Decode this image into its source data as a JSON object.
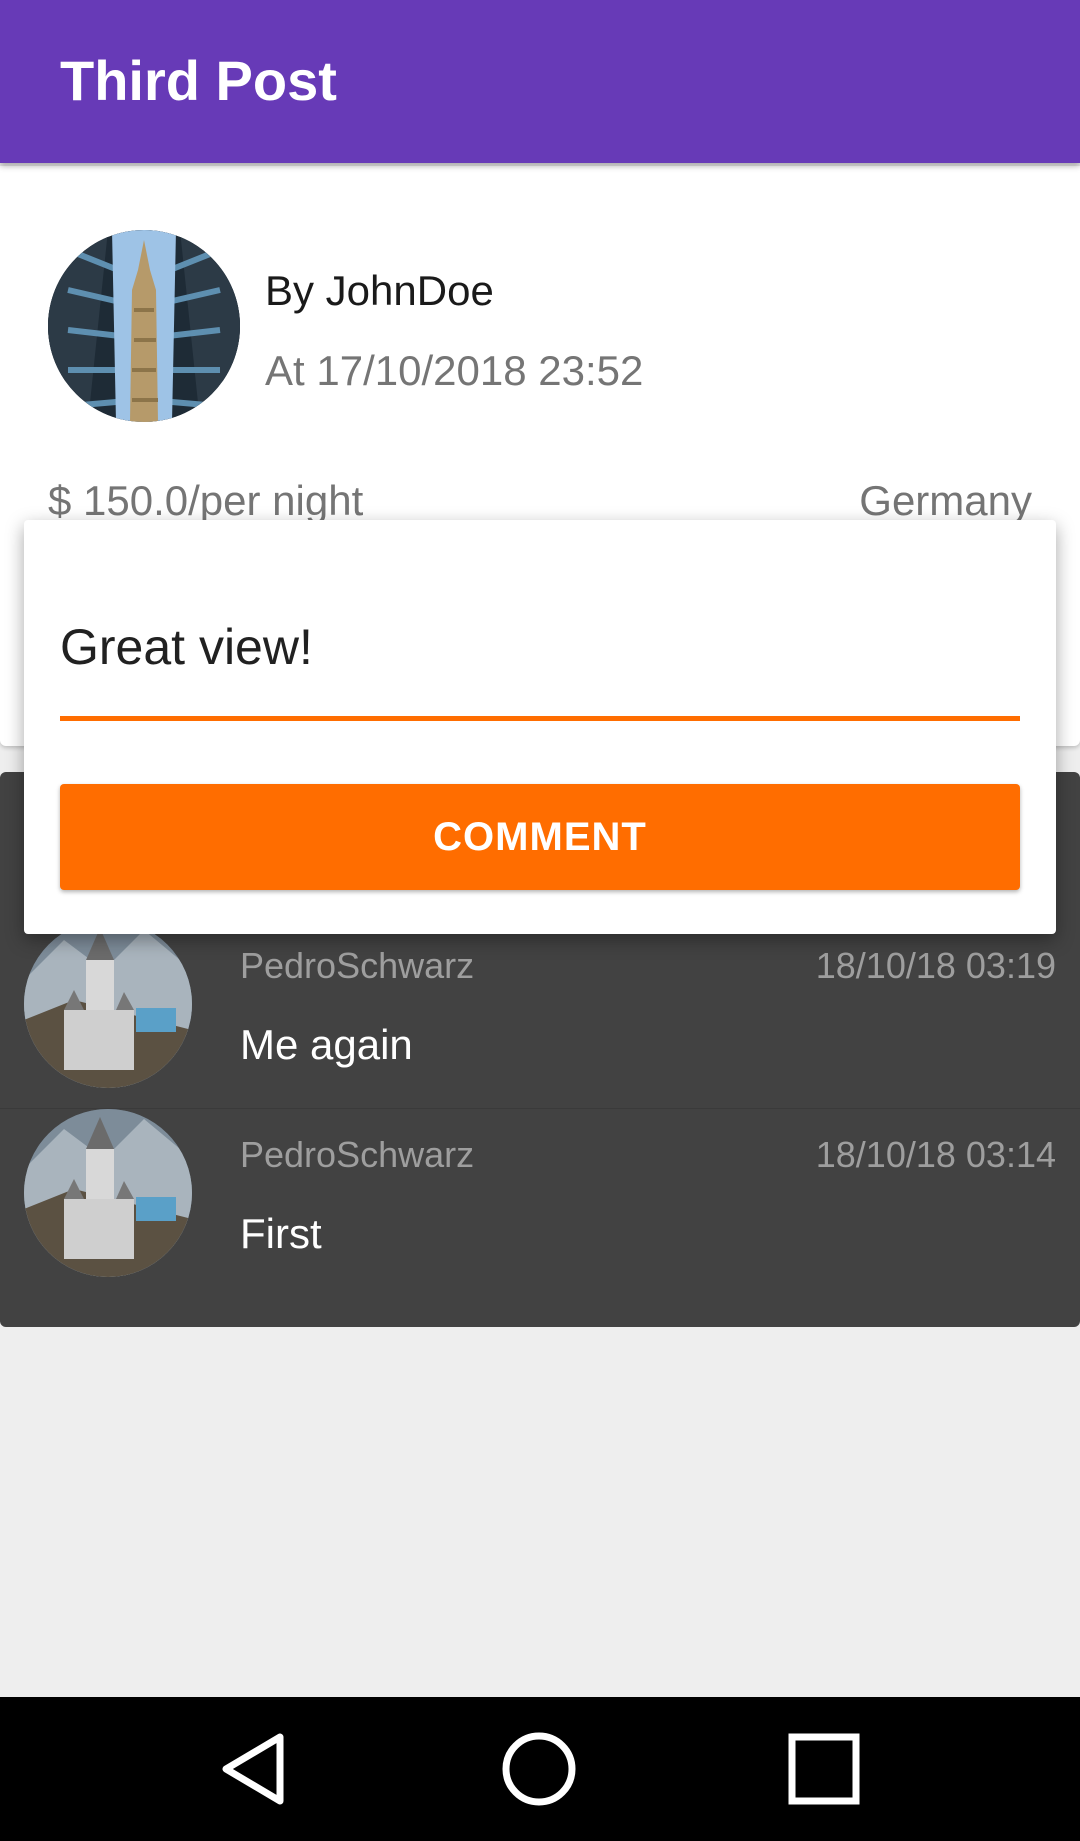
{
  "app_bar": {
    "title": "Third Post"
  },
  "post": {
    "author_line": "By JohnDoe",
    "date_line": "At 17/10/2018 23:52",
    "price": "$ 150.0/per night",
    "country": "Germany"
  },
  "dialog": {
    "input_value": "Great view!",
    "button_label": "COMMENT"
  },
  "comments": [
    {
      "user": "PedroSchwarz",
      "time": "18/10/18 03:19",
      "text": "Me again"
    },
    {
      "user": "PedroSchwarz",
      "time": "18/10/18 03:14",
      "text": "First"
    }
  ],
  "nav_bar": {
    "icons": [
      "back-icon",
      "home-icon",
      "recent-apps-icon"
    ]
  },
  "colors": {
    "primary": "#673ab7",
    "accent": "#ff6d00",
    "comments_bg": "#424242"
  }
}
